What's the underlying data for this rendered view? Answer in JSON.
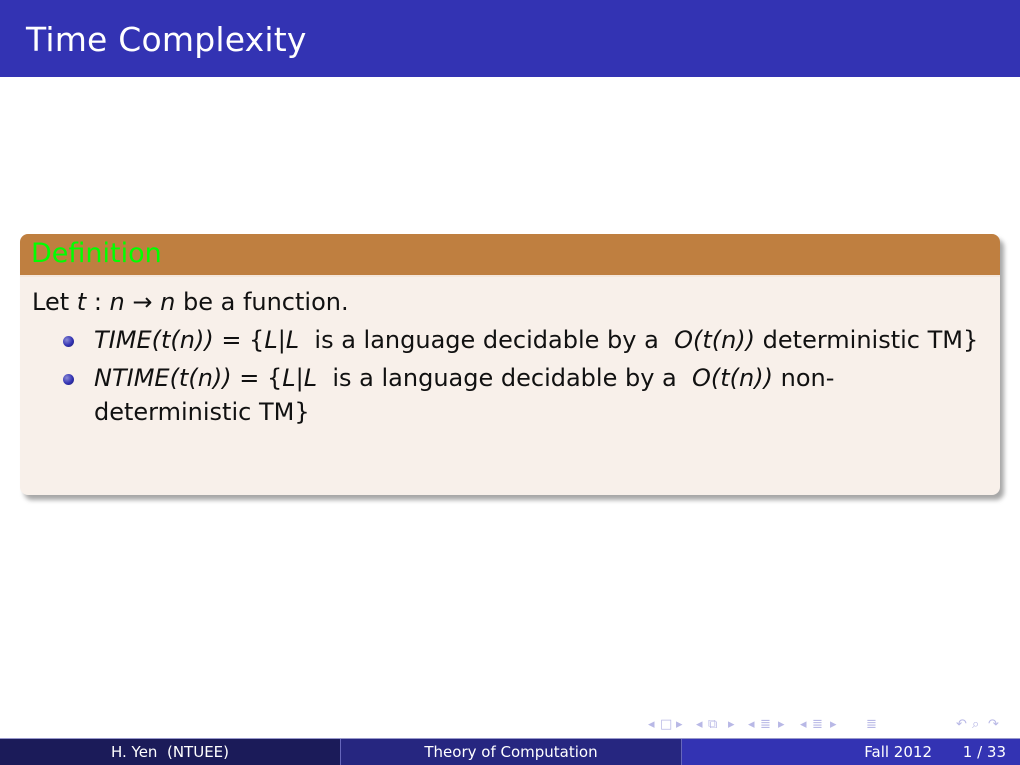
{
  "slide": {
    "title": "Time Complexity"
  },
  "block": {
    "title": "Definition",
    "intro": {
      "prefix": "Let ",
      "var_t": "t",
      "colon": " : ",
      "var_n1": "n",
      "arrow": " → ",
      "var_n2": "n",
      "suffix": " be a function."
    },
    "items": [
      {
        "func": "TIME",
        "arg": "(t(n))",
        "eq": " = {",
        "setvar": "L|L",
        "desc": "  is a language decidable by a  ",
        "bound": "O(t(n))",
        "tail": " deterministic TM}"
      },
      {
        "func": "NTIME",
        "arg": "(t(n))",
        "eq": " = {",
        "setvar": "L|L",
        "desc": "  is a language decidable by a  ",
        "bound": "O(t(n))",
        "tail": " non-deterministic TM}"
      }
    ]
  },
  "navigation": {
    "icons": [
      "◂",
      "□",
      "▸",
      "◂",
      "⧉",
      "▸",
      "◂",
      "≣",
      "▸",
      "◂",
      "≣",
      "▸",
      "≣",
      "↶",
      "⌕",
      "↷"
    ]
  },
  "footer": {
    "author": "H. Yen  (NTUEE)",
    "course": "Theory of Computation",
    "date": "Fall 2012",
    "page": "1 / 33"
  },
  "colors": {
    "title_bar": "#3333b3",
    "block_header": "#bf7f40",
    "block_title_text": "#00ff00",
    "block_body": "#f8f0ea"
  }
}
